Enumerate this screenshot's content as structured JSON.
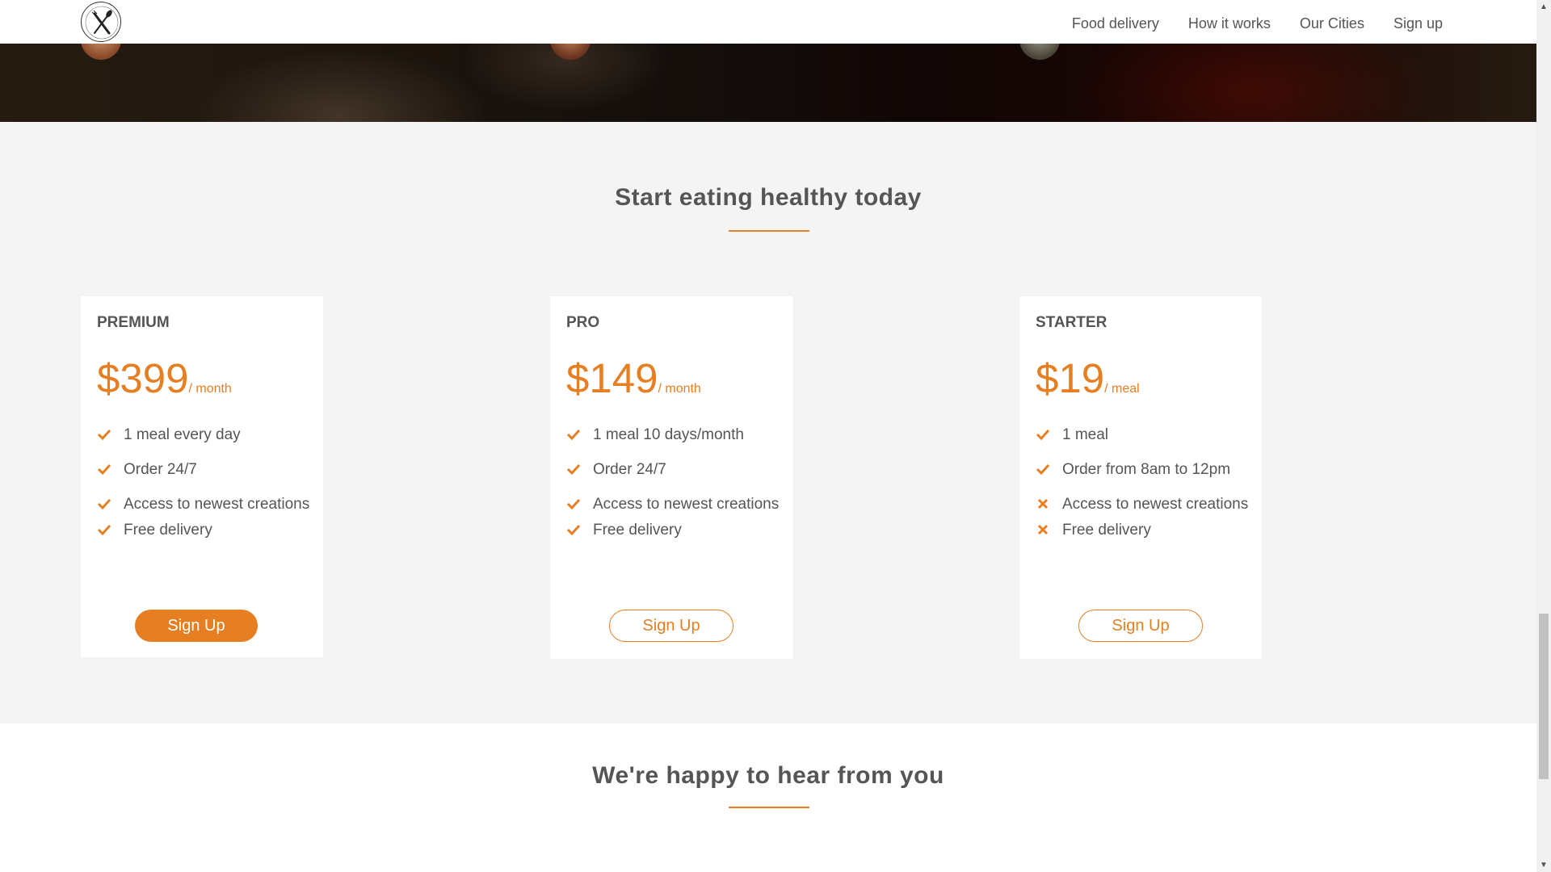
{
  "nav": {
    "links": [
      "Food delivery",
      "How it works",
      "Our Cities",
      "Sign up"
    ]
  },
  "plans_section": {
    "title": "Start eating healthy today",
    "plans": [
      {
        "name": "PREMIUM",
        "price": "$399",
        "unit": "/ month",
        "features": [
          {
            "text": "1 meal every day",
            "included": true
          },
          {
            "text": "Order 24/7",
            "included": true
          },
          {
            "text": "Access to newest creations",
            "included": true
          },
          {
            "text": "Free delivery",
            "included": true
          }
        ],
        "button": "Sign Up",
        "button_style": "full"
      },
      {
        "name": "PRO",
        "price": "$149",
        "unit": "/ month",
        "features": [
          {
            "text": "1 meal 10 days/month",
            "included": true
          },
          {
            "text": "Order 24/7",
            "included": true
          },
          {
            "text": "Access to newest creations",
            "included": true
          },
          {
            "text": "Free delivery",
            "included": true
          }
        ],
        "button": "Sign Up",
        "button_style": "ghost"
      },
      {
        "name": "STARTER",
        "price": "$19",
        "unit": "/ meal",
        "features": [
          {
            "text": "1 meal",
            "included": true
          },
          {
            "text": "Order from 8am to 12pm",
            "included": true
          },
          {
            "text": "Access to newest creations",
            "included": false
          },
          {
            "text": "Free delivery",
            "included": false
          }
        ],
        "button": "Sign Up",
        "button_style": "ghost"
      }
    ]
  },
  "contact_section": {
    "title": "We're happy to hear from you"
  },
  "colors": {
    "accent": "#e67e22",
    "text": "#555555",
    "section_bg": "#f4f4f4"
  },
  "icons": {
    "logo": "fork-knife-logo-icon",
    "included": "checkmark-icon",
    "excluded": "cross-icon"
  }
}
